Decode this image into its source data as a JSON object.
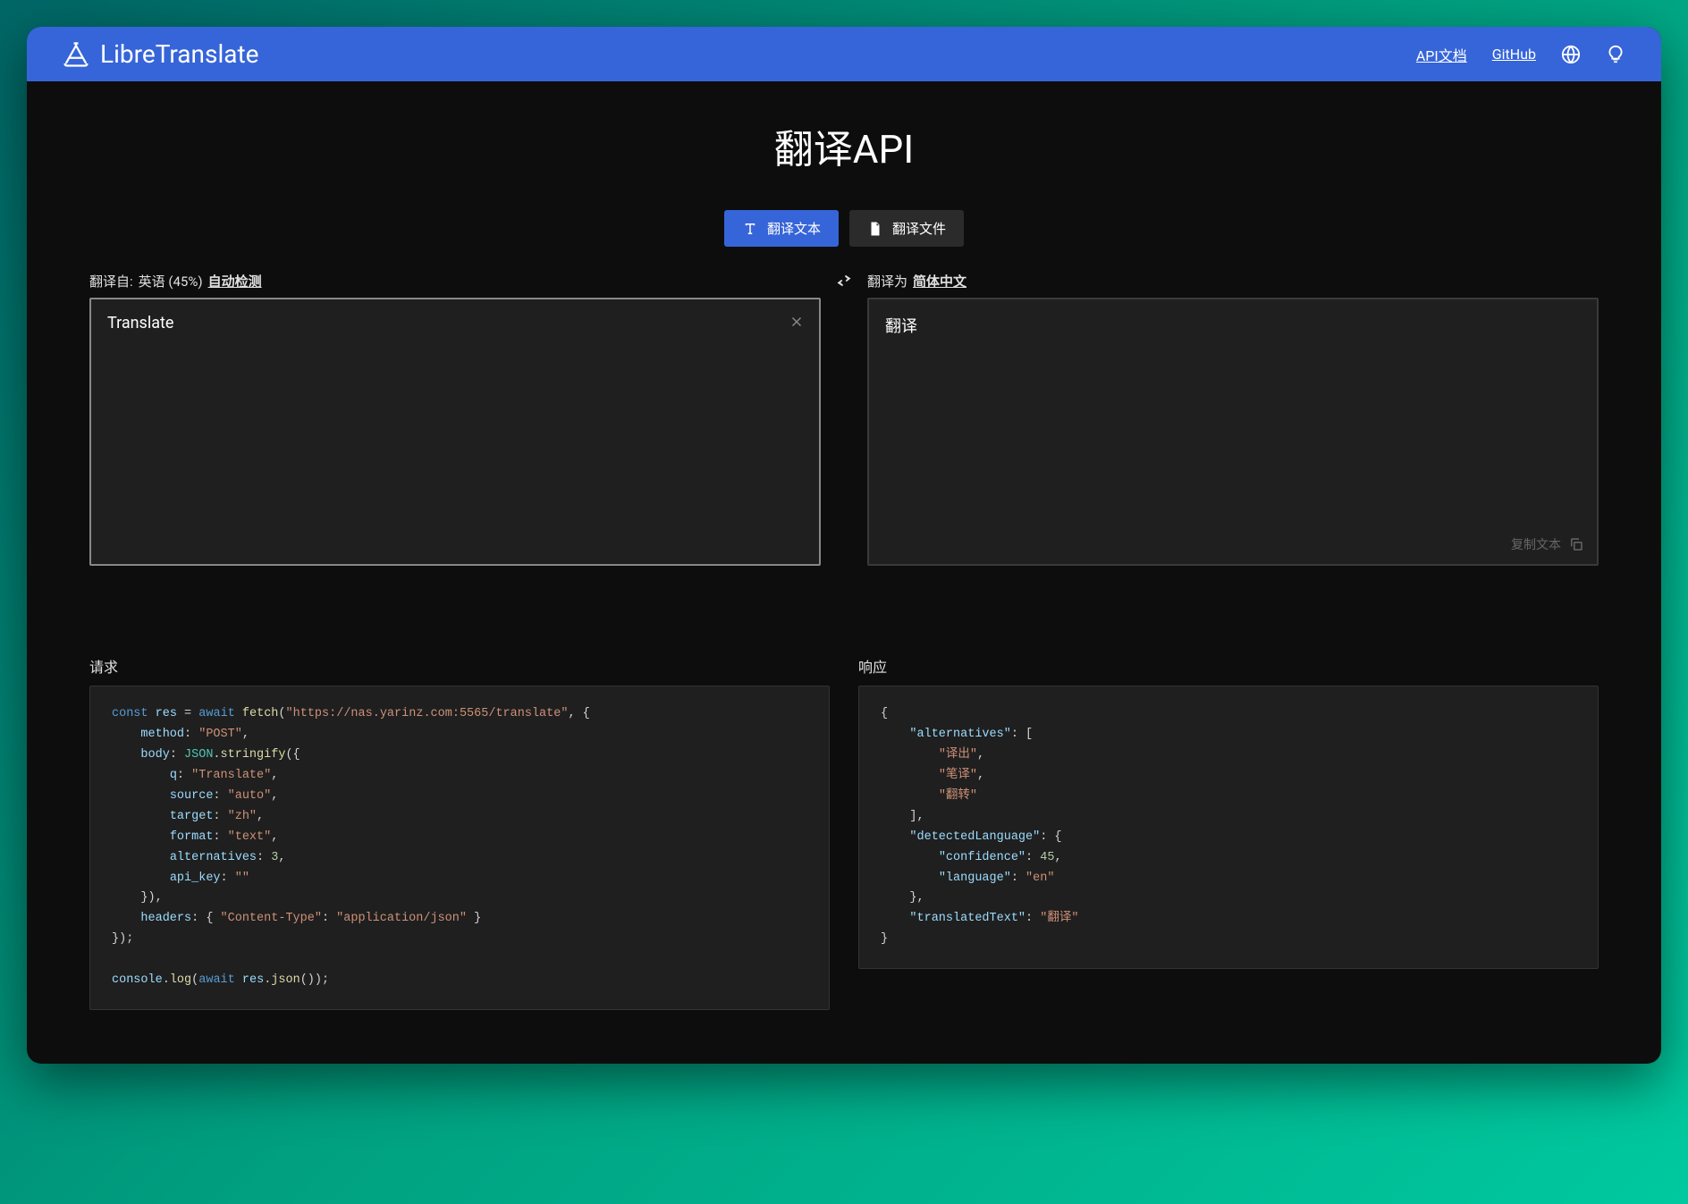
{
  "brand": "LibreTranslate",
  "nav": {
    "api_docs": "API文档",
    "github": "GitHub"
  },
  "page_title": "翻译API",
  "tabs": {
    "text": "翻译文本",
    "file": "翻译文件"
  },
  "source": {
    "label_prefix": "翻译自:",
    "detected": "英语 (45%)",
    "auto_link": "自动检测",
    "value": "Translate"
  },
  "target": {
    "label_prefix": "翻译为",
    "lang_link": "简体中文",
    "value": "翻译",
    "copy_label": "复制文本"
  },
  "code": {
    "request_header": "请求",
    "response_header": "响应",
    "request": {
      "url": "https://nas.yarinz.com:5565/translate",
      "method": "POST",
      "body": {
        "q": "Translate",
        "source": "auto",
        "target": "zh",
        "format": "text",
        "alternatives": 3,
        "api_key": ""
      },
      "content_type": "application/json"
    },
    "response": {
      "alternatives": [
        "译出",
        "笔译",
        "翻转"
      ],
      "detectedLanguage": {
        "confidence": 45,
        "language": "en"
      },
      "translatedText": "翻译"
    }
  }
}
